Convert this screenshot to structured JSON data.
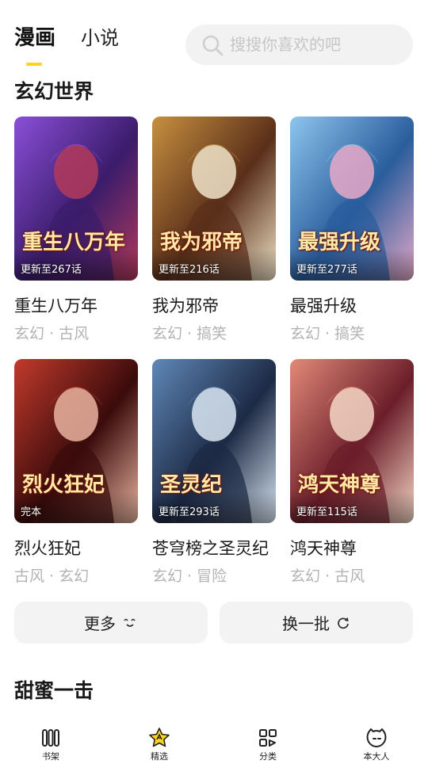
{
  "header": {
    "tabs": [
      {
        "label": "漫画",
        "active": true
      },
      {
        "label": "小说",
        "active": false
      }
    ],
    "search_placeholder": "搜搜你喜欢的吧",
    "accent_color": "#ffd21f"
  },
  "sections": [
    {
      "title": "玄幻世界",
      "items": [
        {
          "title": "重生八万年",
          "tags": "玄幻 · 古风",
          "status": "更新至267话",
          "cover_text": "重生八万年",
          "palette": [
            "#3b1c6b",
            "#8a4fd8",
            "#b23a5a"
          ]
        },
        {
          "title": "我为邪帝",
          "tags": "玄幻 · 搞笑",
          "status": "更新至216话",
          "cover_text": "我为邪帝",
          "palette": [
            "#5a2f1a",
            "#c7903f",
            "#efe3c8"
          ]
        },
        {
          "title": "最强升级",
          "tags": "玄幻 · 搞笑",
          "status": "更新至277话",
          "cover_text": "最强升级",
          "palette": [
            "#2a5d9c",
            "#8ec5ee",
            "#e7a9c8"
          ]
        },
        {
          "title": "烈火狂妃",
          "tags": "古风 · 玄幻",
          "status": "完本",
          "cover_text": "烈火狂妃",
          "palette": [
            "#3a0b0b",
            "#c23a2c",
            "#e9b4a0"
          ]
        },
        {
          "title": "苍穹榜之圣灵纪",
          "tags": "玄幻 · 冒险",
          "status": "更新至293话",
          "cover_text": "圣灵纪",
          "palette": [
            "#1d2a45",
            "#5f88b8",
            "#d9e6f2"
          ]
        },
        {
          "title": "鸿天神尊",
          "tags": "玄幻 · 古风",
          "status": "更新至115话",
          "cover_text": "鸿天神尊",
          "palette": [
            "#6b1e2a",
            "#e28a78",
            "#f5d7c5"
          ]
        }
      ]
    },
    {
      "title": "甜蜜一击",
      "items": []
    }
  ],
  "actions": {
    "more_label": "更多",
    "refresh_label": "换一批"
  },
  "bottom_nav": [
    {
      "label": "书架",
      "icon": "bookshelf-icon"
    },
    {
      "label": "精选",
      "icon": "featured-star-icon",
      "active": true
    },
    {
      "label": "分类",
      "icon": "category-grid-icon"
    },
    {
      "label": "本大人",
      "icon": "profile-face-icon"
    }
  ]
}
